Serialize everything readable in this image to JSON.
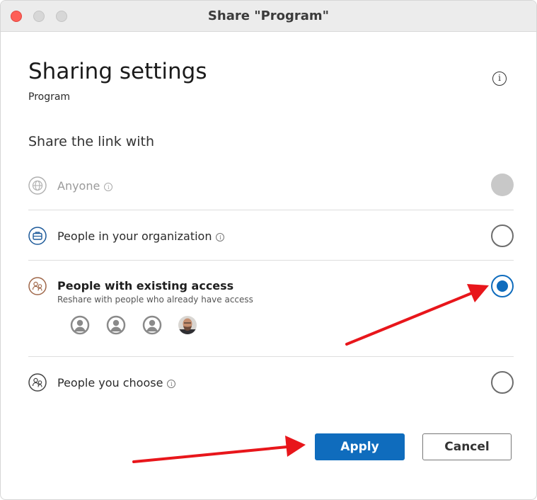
{
  "window": {
    "title": "Share \"Program\""
  },
  "header": {
    "heading": "Sharing settings",
    "subheading": "Program",
    "info_icon": "info-icon"
  },
  "share_section": {
    "label": "Share the link with",
    "options": [
      {
        "label": "Anyone",
        "icon": "globe-icon",
        "state": "disabled"
      },
      {
        "label": "People in your organization",
        "icon": "briefcase-icon",
        "state": "unselected"
      },
      {
        "label": "People with existing access",
        "description": "Reshare with people who already have access",
        "icon": "people-icon",
        "state": "selected"
      },
      {
        "label": "People you choose",
        "icon": "people-icon",
        "state": "unselected"
      }
    ],
    "avatars": [
      "default-user-avatar",
      "default-user-avatar",
      "default-user-avatar",
      "user-photo-avatar"
    ]
  },
  "buttons": {
    "apply": "Apply",
    "cancel": "Cancel"
  },
  "colors": {
    "accent": "#0f6cbd",
    "annotation_arrow": "#e8161b",
    "close_button": "#fe5f57"
  }
}
